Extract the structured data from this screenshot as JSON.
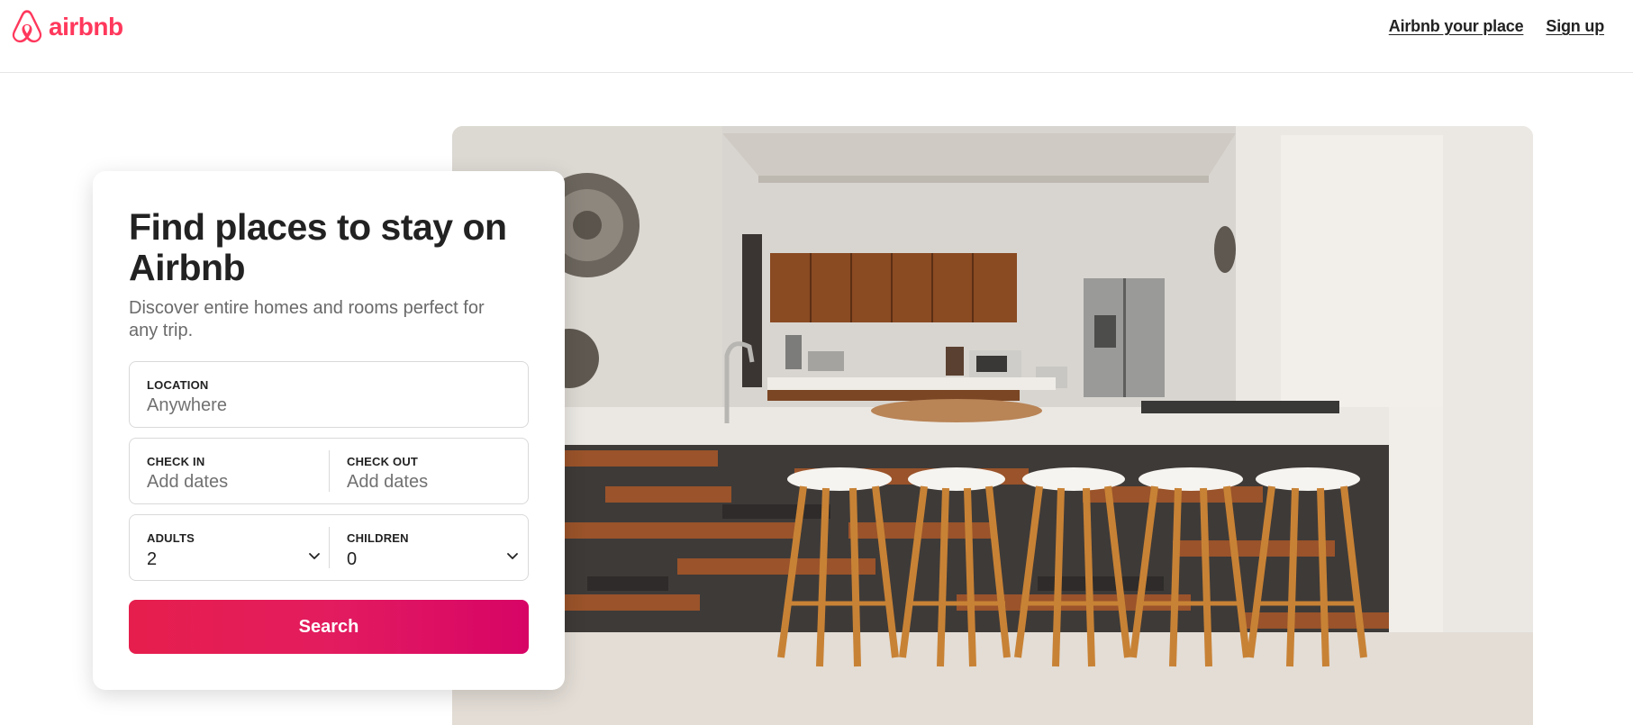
{
  "header": {
    "logo_text": "airbnb",
    "links": [
      {
        "label": "Airbnb your place"
      },
      {
        "label": "Sign up"
      }
    ]
  },
  "card": {
    "title": "Find places to stay on Airbnb",
    "subtitle": "Discover entire homes and rooms perfect for any trip.",
    "location": {
      "label": "LOCATION",
      "placeholder": "Anywhere"
    },
    "check_in": {
      "label": "CHECK IN",
      "placeholder": "Add dates"
    },
    "check_out": {
      "label": "CHECK OUT",
      "placeholder": "Add dates"
    },
    "adults": {
      "label": "ADULTS",
      "value": "2"
    },
    "children": {
      "label": "CHILDREN",
      "value": "0"
    },
    "search_label": "Search"
  },
  "colors": {
    "brand": "#ff385c",
    "button_start": "#e61e4d",
    "button_end": "#d70466"
  },
  "icons": {
    "logo": "airbnb-belo-icon",
    "select": "chevron-down-icon"
  }
}
